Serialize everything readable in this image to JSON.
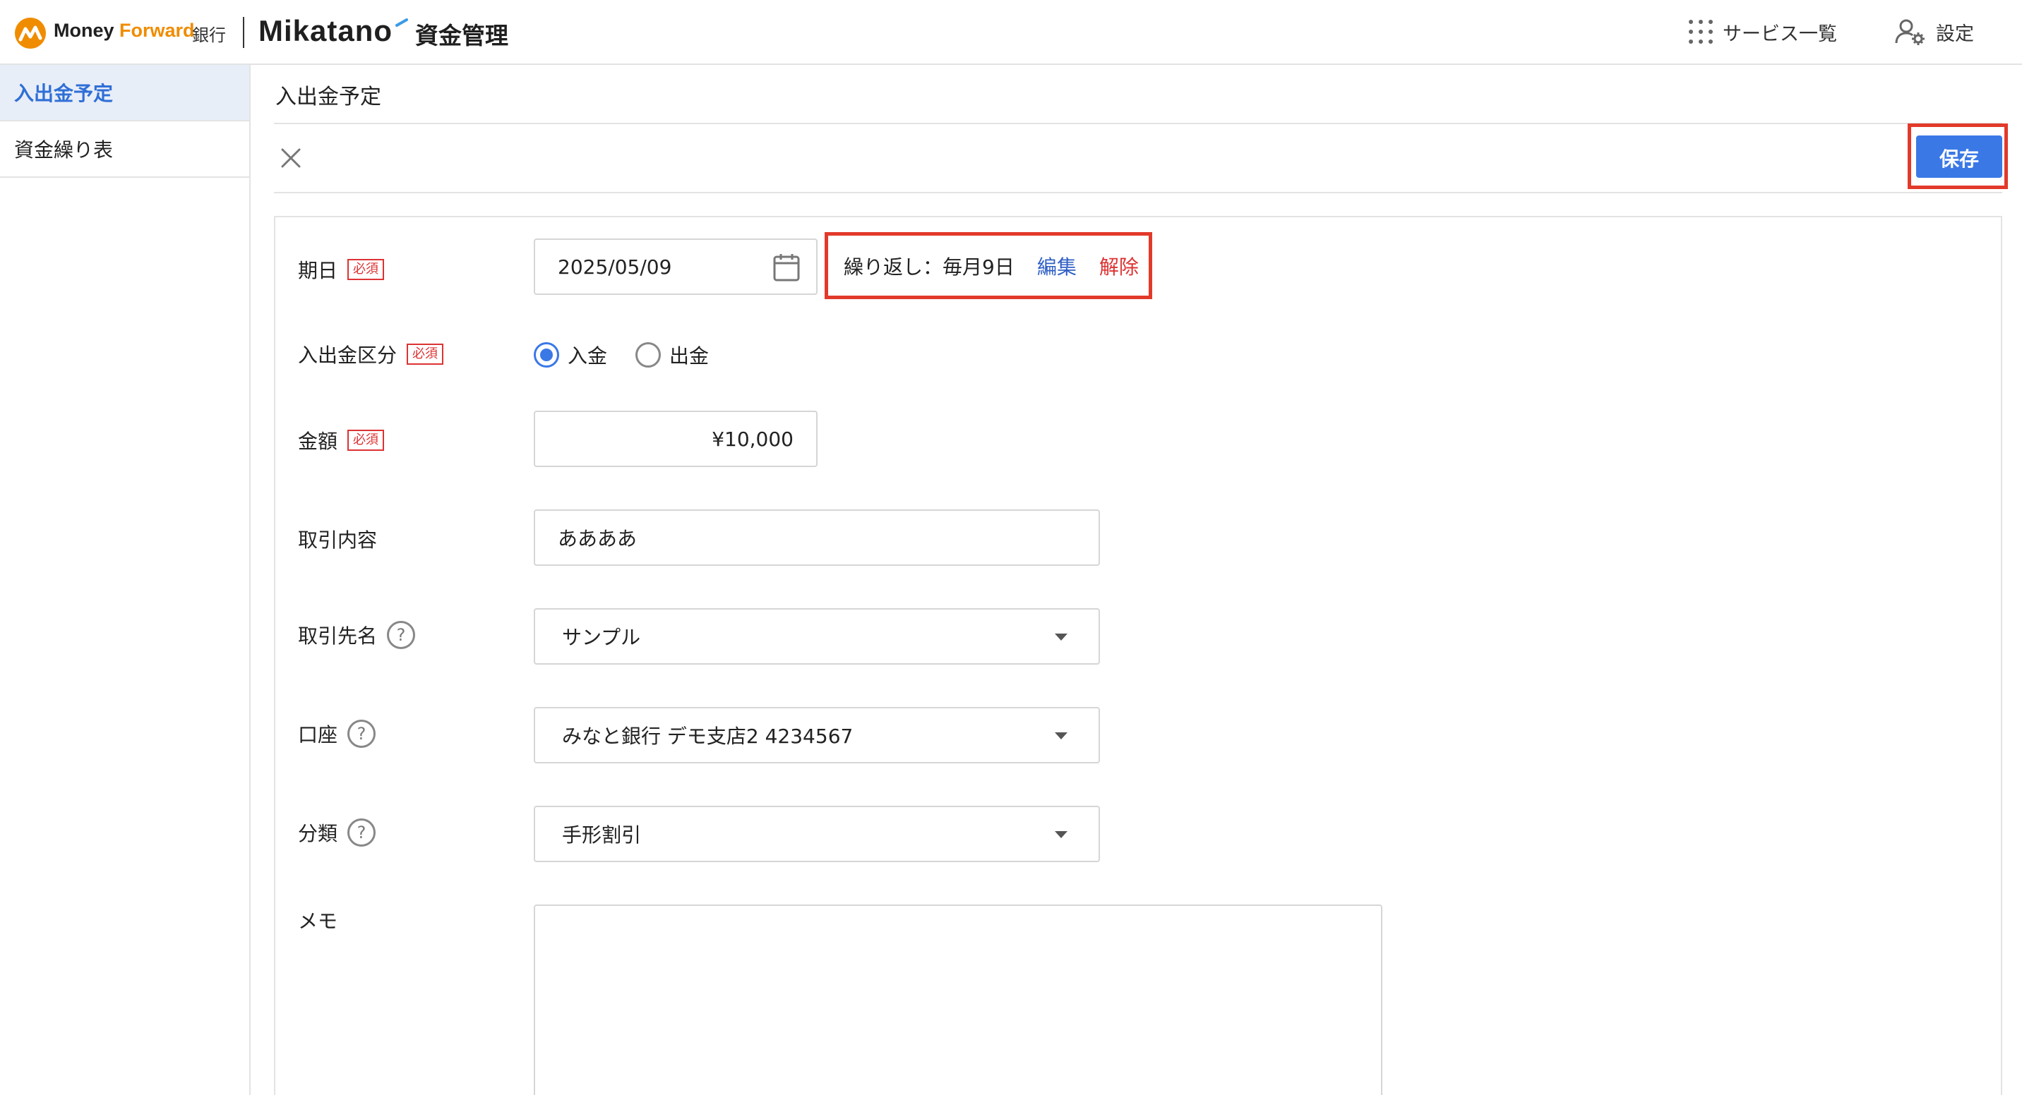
{
  "header": {
    "brand_mf_1": "Money ",
    "brand_mf_2": "Forward",
    "brand_bank": "銀行",
    "product": "Mikatano",
    "product_suffix": "資金管理",
    "services_label": "サービス一覧",
    "settings_label": "設定"
  },
  "sidebar": {
    "items": [
      {
        "label": "入出金予定",
        "active": true
      },
      {
        "label": "資金繰り表",
        "active": false
      }
    ]
  },
  "main": {
    "page_title": "入出金予定",
    "save_label": "保存"
  },
  "form": {
    "required_badge": "必須",
    "due_date": {
      "label": "期日",
      "value": "2025/05/09",
      "repeat_text": "繰り返し：毎月9日",
      "edit_label": "編集",
      "remove_label": "解除"
    },
    "type": {
      "label": "入出金区分",
      "options": [
        "入金",
        "出金"
      ],
      "selected": "入金"
    },
    "amount": {
      "label": "金額",
      "value": "¥10,000"
    },
    "description": {
      "label": "取引内容",
      "value": "ああああ"
    },
    "partner": {
      "label": "取引先名",
      "value": "サンプル"
    },
    "account": {
      "label": "口座",
      "value": "みなと銀行 デモ支店2 4234567"
    },
    "category": {
      "label": "分類",
      "value": "手形割引"
    },
    "memo": {
      "label": "メモ",
      "value": ""
    },
    "help_glyph": "?"
  },
  "colors": {
    "accent": "#3a78e6",
    "highlight_frame": "#e23a2a",
    "required": "#dd3333",
    "brand_orange": "#f08c00"
  }
}
